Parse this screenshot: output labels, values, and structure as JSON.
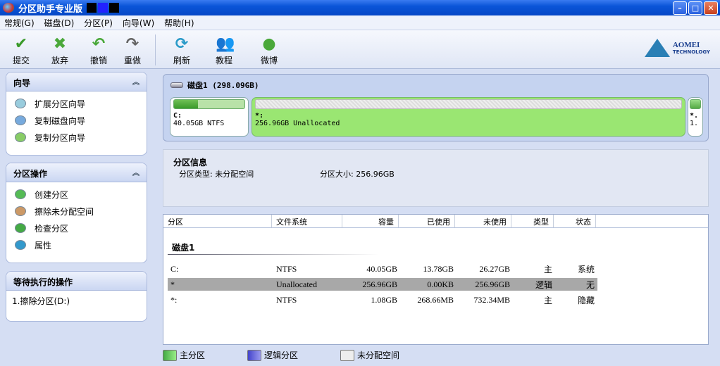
{
  "window": {
    "title": "分区助手专业版",
    "min": "–",
    "max": "□",
    "close": "✕"
  },
  "menu": [
    "常规(G)",
    "磁盘(D)",
    "分区(P)",
    "向导(W)",
    "帮助(H)"
  ],
  "toolbar": {
    "commit": "提交",
    "discard": "放弃",
    "undo": "撤销",
    "redo": "重做",
    "refresh": "刷新",
    "tutorial": "教程",
    "weibo": "微博"
  },
  "logo": {
    "name": "AOMEI",
    "sub": "TECHNOLOGY"
  },
  "wizard": {
    "title": "向导",
    "items": [
      "扩展分区向导",
      "复制磁盘向导",
      "复制分区向导"
    ]
  },
  "ops": {
    "title": "分区操作",
    "items": [
      "创建分区",
      "擦除未分配空间",
      "检查分区",
      "属性"
    ]
  },
  "pending": {
    "title": "等待执行的操作",
    "items": [
      "1.擦除分区(D:)"
    ]
  },
  "disk": {
    "title": "磁盘1 (298.09GB)",
    "parts": [
      {
        "name": "C:",
        "desc": "40.05GB NTFS",
        "used_fraction": 0.34
      },
      {
        "name": "*:",
        "desc": "256.96GB Unallocated"
      },
      {
        "name": "*.",
        "desc": "1."
      }
    ]
  },
  "info": {
    "title": "分区信息",
    "type": "分区类型: 未分配空间",
    "size": "分区大小: 256.96GB"
  },
  "table": {
    "headers": [
      "分区",
      "文件系统",
      "容量",
      "已使用",
      "未使用",
      "类型",
      "状态"
    ],
    "group": "磁盘1",
    "rows": [
      [
        "C:",
        "NTFS",
        "40.05GB",
        "13.78GB",
        "26.27GB",
        "主",
        "系统"
      ],
      [
        "*",
        "Unallocated",
        "256.96GB",
        "0.00KB",
        "256.96GB",
        "逻辑",
        "无"
      ],
      [
        "*:",
        "NTFS",
        "1.08GB",
        "268.66MB",
        "732.34MB",
        "主",
        "隐藏"
      ]
    ]
  },
  "legend": [
    "主分区",
    "逻辑分区",
    "未分配空间"
  ],
  "colors": {
    "primary": "#7ccf63",
    "logical": "#6f6fe0",
    "unallocated": "#eeeeee",
    "selected": "#a8a8a8"
  }
}
